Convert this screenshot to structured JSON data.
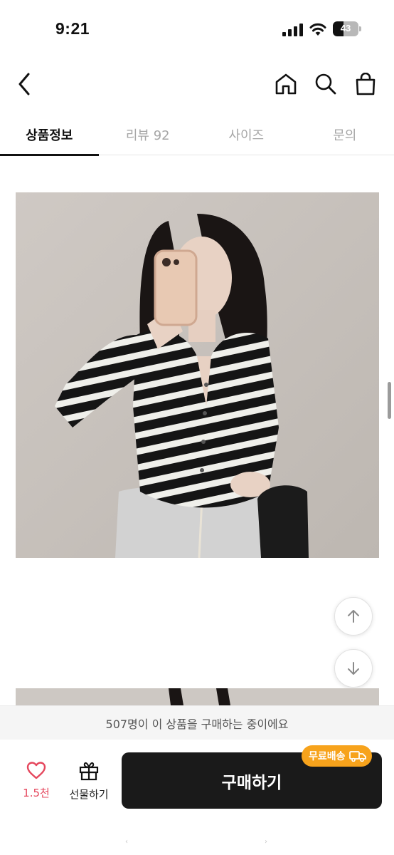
{
  "status_bar": {
    "time": "9:21",
    "battery": "43",
    "battery_level": 0.43
  },
  "nav": {
    "back_icon": "chevron-left-icon",
    "home_icon": "home-icon",
    "search_icon": "search-icon",
    "cart_icon": "shopping-bag-icon"
  },
  "tabs": [
    {
      "label": "상품정보",
      "active": true
    },
    {
      "label": "리뷰 92",
      "active": false
    },
    {
      "label": "사이즈",
      "active": false
    },
    {
      "label": "문의",
      "active": false
    }
  ],
  "floating": {
    "up_icon": "arrow-up-icon",
    "down_icon": "arrow-down-icon"
  },
  "notice": {
    "text": "507명이 이 상품을 구매하는 중이에요"
  },
  "bottom_bar": {
    "like_icon": "heart-icon",
    "like_count": "1.5천",
    "gift_icon": "gift-icon",
    "gift_label": "선물하기",
    "buy_label": "구매하기",
    "shipping_badge": "무료배송",
    "shipping_icon": "truck-icon"
  },
  "colors": {
    "accent_like": "#e5475d",
    "badge": "#f7a31c",
    "buy_button": "#1a1a1a"
  }
}
